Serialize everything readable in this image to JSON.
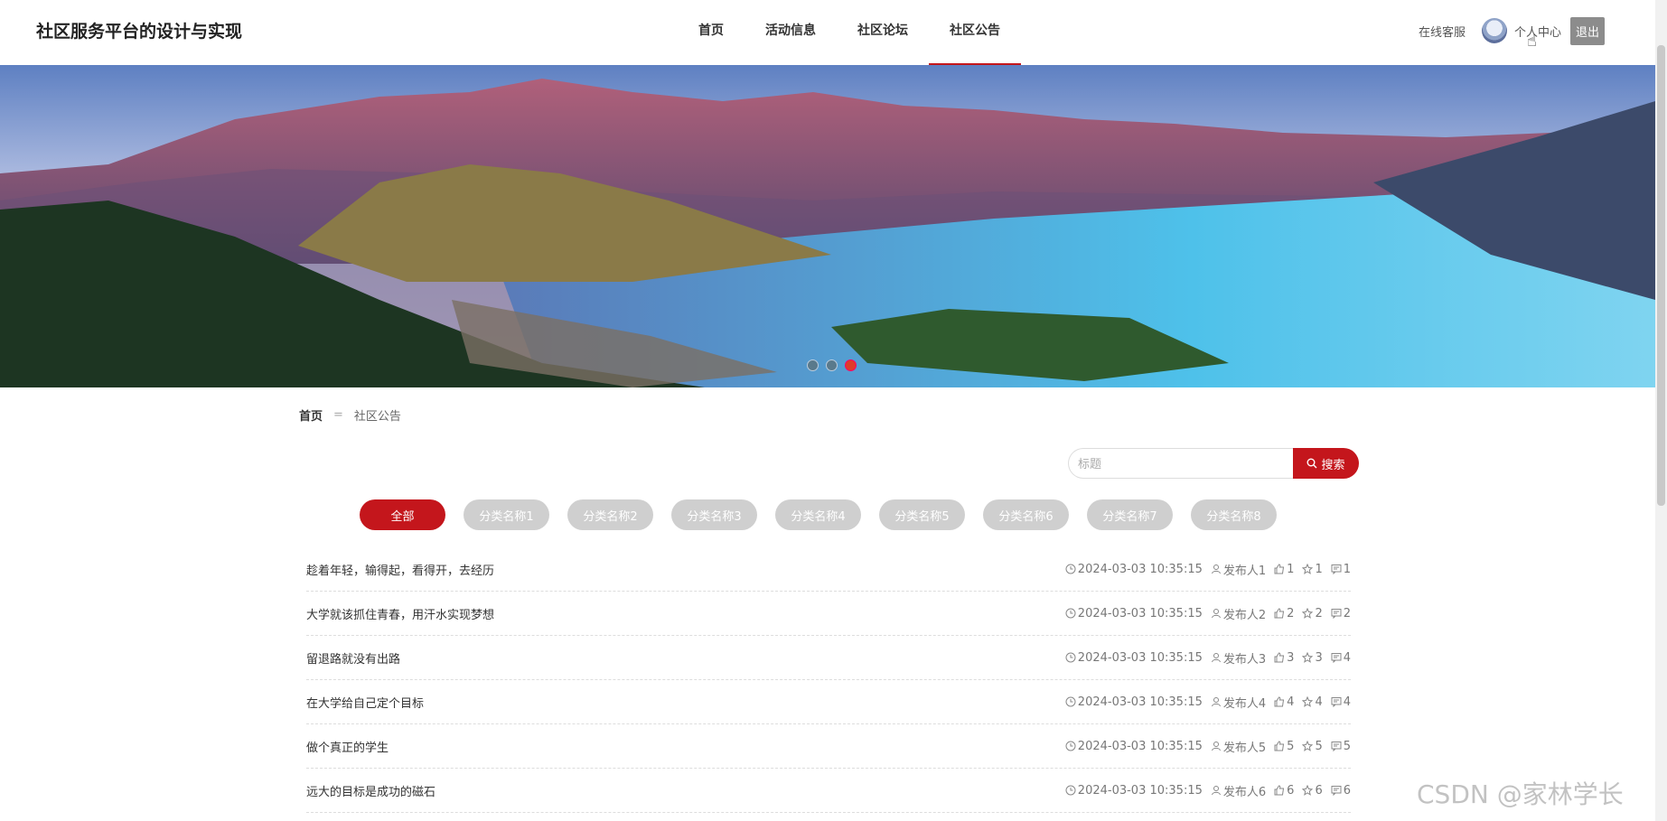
{
  "header": {
    "site_title": "社区服务平台的设计与实现",
    "nav": [
      {
        "label": "首页",
        "active": false
      },
      {
        "label": "活动信息",
        "active": false
      },
      {
        "label": "社区论坛",
        "active": false
      },
      {
        "label": "社区公告",
        "active": true
      }
    ],
    "service_label": "在线客服",
    "profile_label": "个人中心",
    "logout_label": "退出"
  },
  "banner": {
    "slide_count": 3,
    "active_slide": 3
  },
  "breadcrumb": {
    "home": "首页",
    "separator": "=",
    "current": "社区公告"
  },
  "search": {
    "placeholder": "标题",
    "button_label": "搜索"
  },
  "categories": [
    {
      "label": "全部",
      "active": true
    },
    {
      "label": "分类名称1",
      "active": false
    },
    {
      "label": "分类名称2",
      "active": false
    },
    {
      "label": "分类名称3",
      "active": false
    },
    {
      "label": "分类名称4",
      "active": false
    },
    {
      "label": "分类名称5",
      "active": false
    },
    {
      "label": "分类名称6",
      "active": false
    },
    {
      "label": "分类名称7",
      "active": false
    },
    {
      "label": "分类名称8",
      "active": false
    }
  ],
  "items": [
    {
      "title": "趁着年轻，输得起，看得开，去经历",
      "time": "2024-03-03 10:35:15",
      "author": "发布人1",
      "likes": "1",
      "favorites": "1",
      "comments": "1"
    },
    {
      "title": "大学就该抓住青春，用汗水实现梦想",
      "time": "2024-03-03 10:35:15",
      "author": "发布人2",
      "likes": "2",
      "favorites": "2",
      "comments": "2"
    },
    {
      "title": "留退路就没有出路",
      "time": "2024-03-03 10:35:15",
      "author": "发布人3",
      "likes": "3",
      "favorites": "3",
      "comments": "4"
    },
    {
      "title": "在大学给自己定个目标",
      "time": "2024-03-03 10:35:15",
      "author": "发布人4",
      "likes": "4",
      "favorites": "4",
      "comments": "4"
    },
    {
      "title": "做个真正的学生",
      "time": "2024-03-03 10:35:15",
      "author": "发布人5",
      "likes": "5",
      "favorites": "5",
      "comments": "5"
    },
    {
      "title": "远大的目标是成功的磁石",
      "time": "2024-03-03 10:35:15",
      "author": "发布人6",
      "likes": "6",
      "favorites": "6",
      "comments": "6"
    }
  ],
  "watermark": "CSDN @家林学长",
  "colors": {
    "accent": "#c4161c"
  }
}
